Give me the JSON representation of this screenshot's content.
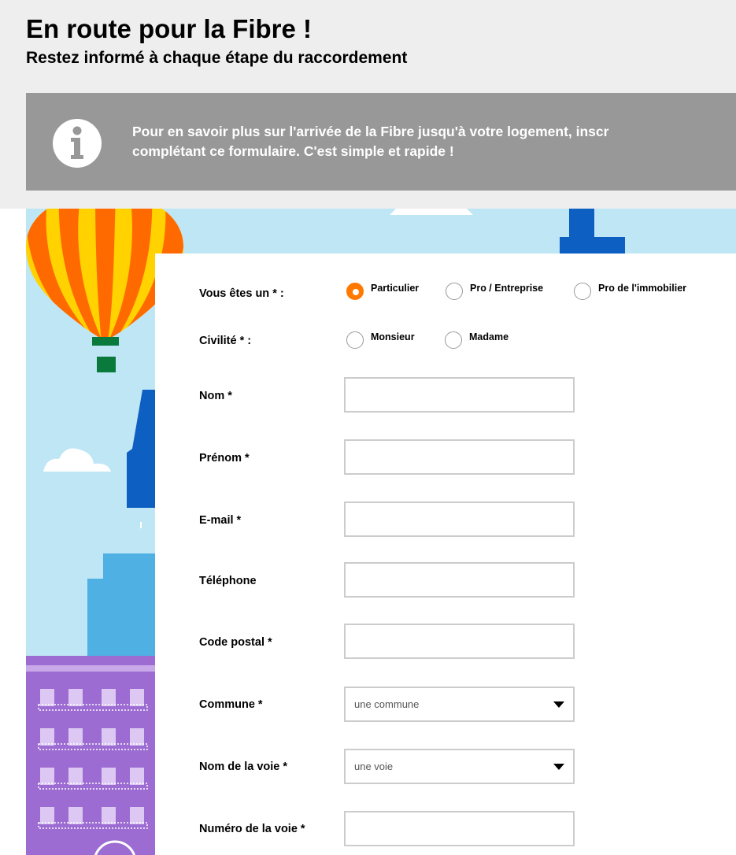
{
  "header": {
    "title": "En route pour la Fibre !",
    "subtitle": "Restez informé à chaque étape du raccordement"
  },
  "info_banner": {
    "icon": "info-icon",
    "line1": "Pour en savoir plus sur l'arrivée de la Fibre jusqu'à votre logement, inscr",
    "line2": "complétant ce formulaire. C'est simple et rapide !"
  },
  "form": {
    "profile": {
      "label": "Vous êtes un * :",
      "options": [
        "Particulier",
        "Pro / Entreprise",
        "Pro de l'immobilier"
      ],
      "selected": "Particulier"
    },
    "civility": {
      "label": "Civilité * :",
      "options": [
        "Monsieur",
        "Madame"
      ]
    },
    "fields": {
      "nom": {
        "label": "Nom *",
        "value": ""
      },
      "prenom": {
        "label": "Prénom *",
        "value": ""
      },
      "email": {
        "label": "E-mail *",
        "value": ""
      },
      "telephone": {
        "label": "Téléphone",
        "value": ""
      },
      "code_postal": {
        "label": "Code postal *",
        "value": ""
      },
      "commune": {
        "label": "Commune *",
        "placeholder": "une commune"
      },
      "voie": {
        "label": "Nom de la voie *",
        "placeholder": "une voie"
      },
      "numero": {
        "label": "Numéro de la voie *",
        "value": ""
      }
    }
  },
  "colors": {
    "accent": "#ff7900",
    "banner": "#989898",
    "sky": "#bfe6f5",
    "building_blue": "#0d5fc2",
    "building_purple": "#9c6cd2"
  }
}
